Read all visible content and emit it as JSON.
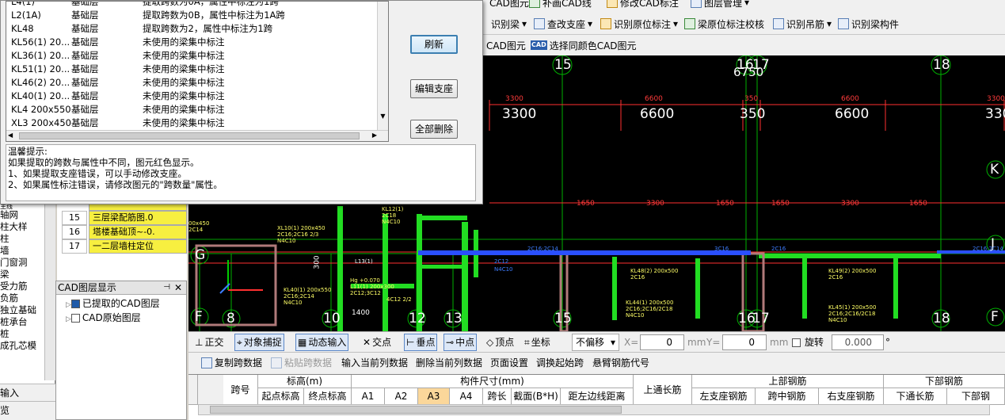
{
  "dialog": {
    "rows": [
      {
        "name": "L4(1)",
        "layer": "基础层",
        "desc": "提取跨数为0A，属性中标注为1跨"
      },
      {
        "name": "L2(1A)",
        "layer": "基础层",
        "desc": "提取跨数为0B，属性中标注为1A跨"
      },
      {
        "name": "KL48",
        "layer": "基础层",
        "desc": "提取跨数为2，属性中标注为1跨"
      },
      {
        "name": "KL56(1) 20...",
        "layer": "基础层",
        "desc": "未使用的梁集中标注"
      },
      {
        "name": "KL36(1) 20...",
        "layer": "基础层",
        "desc": "未使用的梁集中标注"
      },
      {
        "name": "KL51(1) 20...",
        "layer": "基础层",
        "desc": "未使用的梁集中标注"
      },
      {
        "name": "KL46(2) 20...",
        "layer": "基础层",
        "desc": "未使用的梁集中标注"
      },
      {
        "name": "KL40(1) 20...",
        "layer": "基础层",
        "desc": "未使用的梁集中标注"
      },
      {
        "name": "KL4 200x550",
        "layer": "基础层",
        "desc": "未使用的梁集中标注"
      },
      {
        "name": "XL3 200x450",
        "layer": "基础层",
        "desc": "未使用的梁集中标注"
      }
    ],
    "tips_title": "温馨提示:",
    "tips": [
      "如果提取的跨数与属性中不同，图元红色显示。",
      "1、如果提取支座错误，可以手动修改支座。",
      "2、如果属性标注错误，请修改图元的\"跨数量\"属性。"
    ],
    "btn_refresh": "刷新",
    "btn_edit_support": "编辑支座",
    "btn_delete_all": "全部删除"
  },
  "toolbar": {
    "row1": [
      "CAD图元",
      "补画CAD线",
      "修改CAD标注",
      "图层管理"
    ],
    "row2": [
      "识别梁",
      "查改支座",
      "识别原位标注",
      "梁原位标注校核",
      "识别吊筋",
      "识别梁构件"
    ],
    "row3": [
      "CAD图元",
      "选择同颜色CAD图元"
    ]
  },
  "canvas": {
    "axis_top": [
      "15",
      "16",
      "17",
      "18"
    ],
    "axis_top_dim": "6750",
    "dims_red": [
      "3300",
      "6600",
      "350",
      "6600",
      "3300"
    ],
    "dims_white": [
      "3300",
      "6600",
      "350",
      "6600",
      "3300"
    ],
    "mid_dims": [
      "1650",
      "3300",
      "1650",
      "1650",
      "3300",
      "1650"
    ],
    "axis_right": [
      "K",
      "J",
      "F"
    ],
    "axis_left": [
      "G",
      "F"
    ],
    "axis_bottom": [
      "8",
      "10",
      "12",
      "13",
      "15",
      "16",
      "17",
      "18"
    ],
    "small_texts": {
      "t1400": "1400",
      "t300": "300",
      "hg": "Hg +0.070\nL11(1) 200x300\n2C12;3C12",
      "kl40": "KL40(1) 200x550\n2C16;2C14\nN4C10",
      "kl48": "KL48(2) 200x500\n2C16",
      "kl44": "KL44(1) 200x500\n2C16;2C16/2C18\nN4C10",
      "kl49": "KL49(2) 200x500\n2C16",
      "kl45": "KL45(1) 200x500\n2C16;2C16/2C18\nN4C10",
      "c4": "4C12 2/2",
      "c2c12": "2C12",
      "n4c10": "N4C10",
      "c2c16a": "2C16;2C14",
      "c2c16b": "3C16",
      "c2c16c": "2C16",
      "c2c16d": "2C16;2C14",
      "xl": "XL10(1) 200x450\n2C16;2C16 2/3\nN4C10",
      "kl12": "KL12(1)\n2C18\nN4C10",
      "l13": "L13(1)",
      "left4x": "00x450\n2C14"
    }
  },
  "layer_table": [
    {
      "n": "15",
      "t": "三层梁配筋图.0"
    },
    {
      "n": "16",
      "t": "塔楼基础顶~-0."
    },
    {
      "n": "17",
      "t": "一二层墙柱定位"
    }
  ],
  "left_nav": [
    "轴网",
    "柱大样",
    "柱",
    "墙",
    "门窗洞",
    "梁",
    "受力筋",
    "负筋",
    "独立基础",
    "桩承台",
    "桩",
    "成孔芯模"
  ],
  "left_nav_top": "主线",
  "left_bottom": [
    "输入",
    "览"
  ],
  "cad_layer_panel": {
    "title": "CAD图层显示",
    "items": [
      "已提取的CAD图层",
      "CAD原始图层"
    ]
  },
  "snap": {
    "ortho": "正交",
    "object_snap": "对象捕捉",
    "dynamic_input": "动态输入",
    "intersection": "交点",
    "perpendicular": "垂点",
    "midpoint": "中点",
    "vertex": "顶点",
    "coord": "坐标",
    "offset_select": "不偏移",
    "x_label": "X=",
    "x_val": "0",
    "unit1": "mm",
    "y_label": "Y=",
    "y_val": "0",
    "unit2": "mm",
    "rotate": "旋转",
    "rotate_val": "0.000",
    "deg": "°"
  },
  "table_toolbar": [
    "复制跨数据",
    "粘贴跨数据",
    "输入当前列数据",
    "删除当前列数据",
    "页面设置",
    "调换起始跨",
    "悬臂钢筋代号"
  ],
  "grid": {
    "span_no": "跨号",
    "elevation": "标高(m)",
    "start_elev": "起点标高",
    "end_elev": "终点标高",
    "member_size": "构件尺寸(mm)",
    "a1": "A1",
    "a2": "A2",
    "a3": "A3",
    "a4": "A4",
    "span_len": "跨长",
    "section": "截面(B*H)",
    "edge_dist": "距左边线距离",
    "top_through": "上通长筋",
    "top_rebar": "上部钢筋",
    "left_support": "左支座钢筋",
    "mid_span": "跨中钢筋",
    "right_support": "右支座钢筋",
    "bottom_rebar": "下部钢筋",
    "bottom_through": "下通长筋",
    "bottom_part": "下部钢"
  },
  "colors": {
    "canvas_bg": "#000000",
    "axis_green": "#00c000",
    "beam_green": "#22dd22",
    "dim_red": "#ff3b3b",
    "text_yellow": "#ffff66",
    "rebar_blue": "#3d7dff",
    "highlight_yellow": "#f7ef40"
  }
}
